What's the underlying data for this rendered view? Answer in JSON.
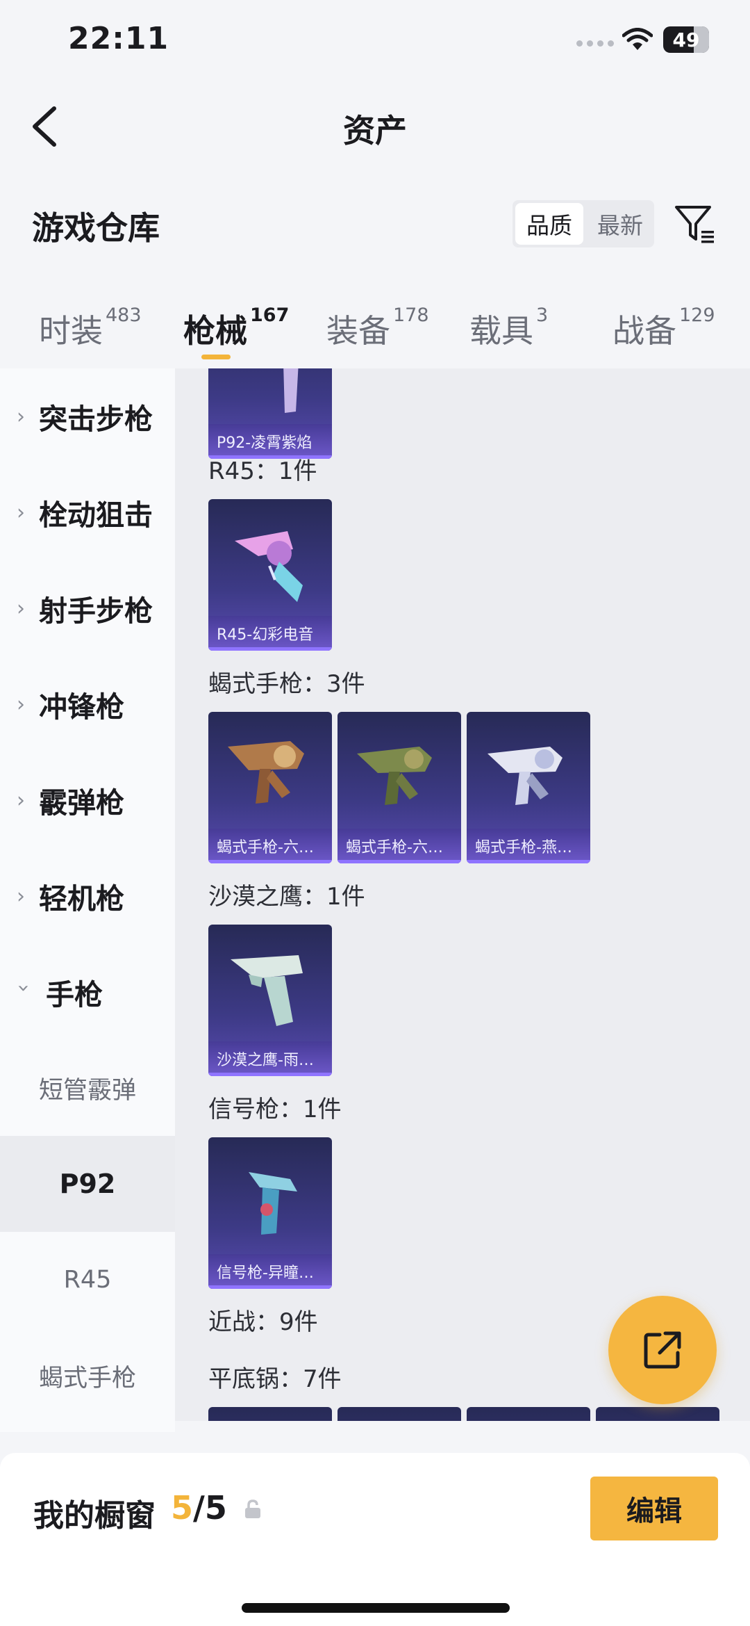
{
  "status": {
    "time": "22:11",
    "battery": "49"
  },
  "header": {
    "title": "资产"
  },
  "section": {
    "title": "游戏仓库",
    "sort_options": [
      "品质",
      "最新"
    ]
  },
  "tabs": [
    {
      "label": "时装",
      "count": "483"
    },
    {
      "label": "枪械",
      "count": "167"
    },
    {
      "label": "装备",
      "count": "178"
    },
    {
      "label": "载具",
      "count": "3"
    },
    {
      "label": "战备",
      "count": "129"
    }
  ],
  "sidebar": {
    "categories": [
      "突击步枪",
      "栓动狙击",
      "射手步枪",
      "冲锋枪",
      "霰弹枪",
      "轻机枪",
      "手枪"
    ],
    "subitems": [
      "短管霰弹",
      "P92",
      "R45",
      "蝎式手枪"
    ]
  },
  "content": {
    "top_card": "P92-凌霄紫焰",
    "groups": [
      {
        "title": "R45：1件",
        "items": [
          "R45-幻彩电音"
        ]
      },
      {
        "title": "蝎式手枪：3件",
        "items": [
          "蝎式手枪-六…",
          "蝎式手枪-六…",
          "蝎式手枪-燕…"
        ]
      },
      {
        "title": "沙漠之鹰：1件",
        "items": [
          "沙漠之鹰-雨…"
        ]
      },
      {
        "title": "信号枪：1件",
        "items": [
          "信号枪-异瞳…"
        ]
      },
      {
        "title": "近战：9件",
        "items": []
      },
      {
        "title": "平底锅：7件",
        "items": []
      }
    ]
  },
  "bottom": {
    "window_label": "我的橱窗",
    "current": "5",
    "total": "/5",
    "edit_label": "编辑"
  },
  "colors": {
    "accent": "#f5b640",
    "card_bg": "#3d3a86",
    "card_caption": "#6d58c9"
  },
  "icons": [
    "back-arrow-icon",
    "filter-icon",
    "share-icon",
    "lock-icon",
    "wifi-icon",
    "chevron-right-icon",
    "chevron-down-icon"
  ]
}
